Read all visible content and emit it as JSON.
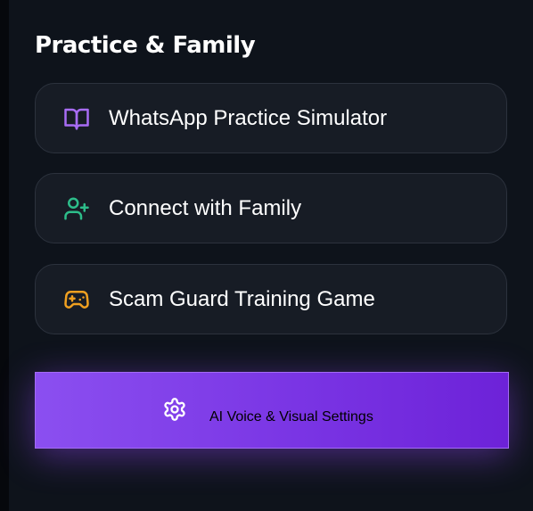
{
  "section": {
    "title": "Practice & Family"
  },
  "menu": {
    "items": [
      {
        "label": "WhatsApp Practice Simulator",
        "icon": "book-open-icon",
        "icon_color": "#a86cf5"
      },
      {
        "label": "Connect with Family",
        "icon": "user-plus-icon",
        "icon_color": "#2dbd8a"
      },
      {
        "label": "Scam Guard Training Game",
        "icon": "gamepad-icon",
        "icon_color": "#f0a020"
      }
    ]
  },
  "settings_button": {
    "label": "AI Voice & Visual Settings",
    "icon": "gear-icon",
    "gradient_start": "#8b4ff0",
    "gradient_end": "#6d22d8"
  }
}
